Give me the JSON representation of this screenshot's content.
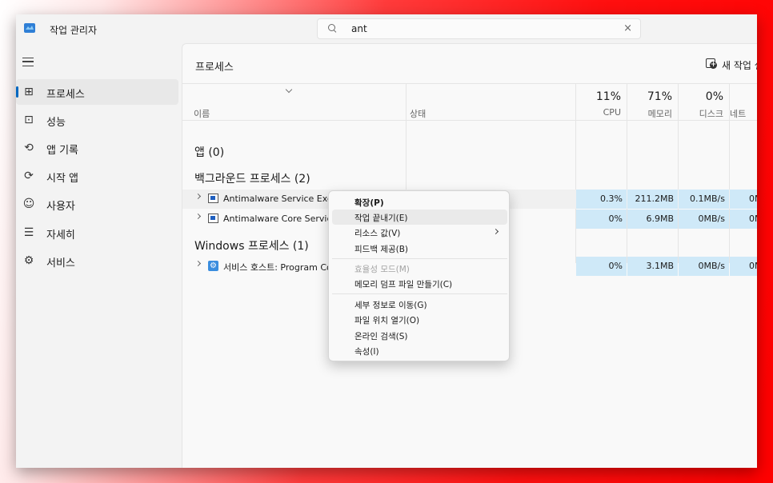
{
  "window": {
    "title": "작업 관리자"
  },
  "search": {
    "value": "ant",
    "clear_glyph": "×"
  },
  "sidebar": {
    "items": [
      {
        "label": "프로세스",
        "icon": "processes-icon",
        "glyph": "⊞"
      },
      {
        "label": "성능",
        "icon": "performance-icon",
        "glyph": "⊡"
      },
      {
        "label": "앱 기록",
        "icon": "app-history-icon",
        "glyph": "⟲"
      },
      {
        "label": "시작 앱",
        "icon": "startup-apps-icon",
        "glyph": "⟳"
      },
      {
        "label": "사용자",
        "icon": "users-icon",
        "glyph": "☺"
      },
      {
        "label": "자세히",
        "icon": "details-icon",
        "glyph": "☰"
      },
      {
        "label": "서비스",
        "icon": "services-icon",
        "glyph": "⚙"
      }
    ]
  },
  "main": {
    "title": "프로세스",
    "new_task_label": "새 작업 실",
    "columns": {
      "name": "이름",
      "status": "상태",
      "cpu_pct": "11%",
      "cpu_label": "CPU",
      "mem_pct": "71%",
      "mem_label": "메모리",
      "disk_pct": "0%",
      "disk_label": "디스크",
      "net_label": "네트"
    },
    "groups": {
      "apps": "앱 (0)",
      "background": "백그라운드 프로세스 (2)",
      "windows": "Windows 프로세스 (1)"
    },
    "rows": [
      {
        "name": "Antimalware Service Executable",
        "cpu": "0.3%",
        "mem": "211.2MB",
        "disk": "0.1MB/s",
        "net": "0M"
      },
      {
        "name": "Antimalware Core Service",
        "cpu": "0%",
        "mem": "6.9MB",
        "disk": "0MB/s",
        "net": "0M"
      },
      {
        "name": "서비스 호스트: Program Co",
        "cpu": "0%",
        "mem": "3.1MB",
        "disk": "0MB/s",
        "net": "0M"
      }
    ]
  },
  "context_menu": {
    "items": [
      "확장(P)",
      "작업 끝내기(E)",
      "리소스 값(V)",
      "피드백 제공(B)",
      "효율성 모드(M)",
      "메모리 덤프 파일 만들기(C)",
      "세부 정보로 이동(G)",
      "파일 위치 열기(O)",
      "온라인 검색(S)",
      "속성(I)"
    ]
  },
  "colors": {
    "accent": "#0067c0",
    "resource_highlight": "#cfe9f8",
    "backdrop": "#ff0000"
  }
}
